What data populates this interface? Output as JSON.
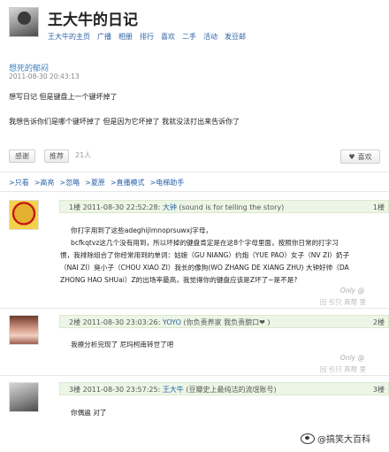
{
  "header": {
    "title": "王大牛的日记",
    "nav": [
      "王大牛的主页",
      "广播",
      "相册",
      "排行",
      "喜欢",
      "二手",
      "活动",
      "发豆邮"
    ]
  },
  "post": {
    "title": "想死的郁闷",
    "time": "2011-08-30 20:43:13",
    "lines": [
      "想写日记 但是键盘上一个键坏掉了",
      "我想告诉你们是哪个键坏掉了 但是因为它坏掉了 我就没法打出来告诉你了"
    ],
    "actions": {
      "recommend": "感谢",
      "share": "推荐",
      "count": "21人",
      "like": "喜欢"
    }
  },
  "linkbar": [
    ">只看",
    ">高亮",
    ">忽略",
    ">夏原",
    ">直播模式",
    ">电梯助手"
  ],
  "comments": [
    {
      "head": "1楼 2011-08-30 22:52:28: ",
      "user": "大钟",
      "note": " (sound is for telling the story)",
      "floor": "1楼",
      "lines": [
        "你打字用到了这些adeghijlmnoprsuwxj字母，",
        "bcfkqtvz这几个没有用到，所以坏掉的键盘肯定是在这8个字母里面，按照你日常的打字习",
        "惯，我排除组合了你经常用到的单词：姑娘（GU NIANG）约炮（YUE PAO）女子（NV ZI）奶子",
        "（NAI ZI）臭小子（CHOU XIAO ZI）我长的像狗(WO ZHANG DE XIANG ZHU) 大钟好帅（DA",
        "ZHONG HAO SHUai）Z的出场率最高，我觉得你的键盘应该是Z坏了~是不是?"
      ],
      "only": "Only @",
      "actions": "回 引只 高帮 里"
    },
    {
      "head": "2楼 2011-08-30 23:03:26: ",
      "user": "YOYO",
      "note": " (你负责养家 我负责貌口❤ )",
      "floor": "2楼",
      "lines": [
        "我擦分析完现了 尼玛柯南转世了吧"
      ],
      "only": "Only @",
      "actions": "回 引只 高帮 里"
    },
    {
      "head": "3楼 2011-08-30 23:57:25: ",
      "user": "王大牛",
      "note": " (豆瓣史上最纯洁的流氓账号)",
      "floor": "3楼",
      "lines": [
        "你偶遍 对了"
      ],
      "only": "",
      "actions": ""
    }
  ],
  "watermark": "@搞笑大百科"
}
